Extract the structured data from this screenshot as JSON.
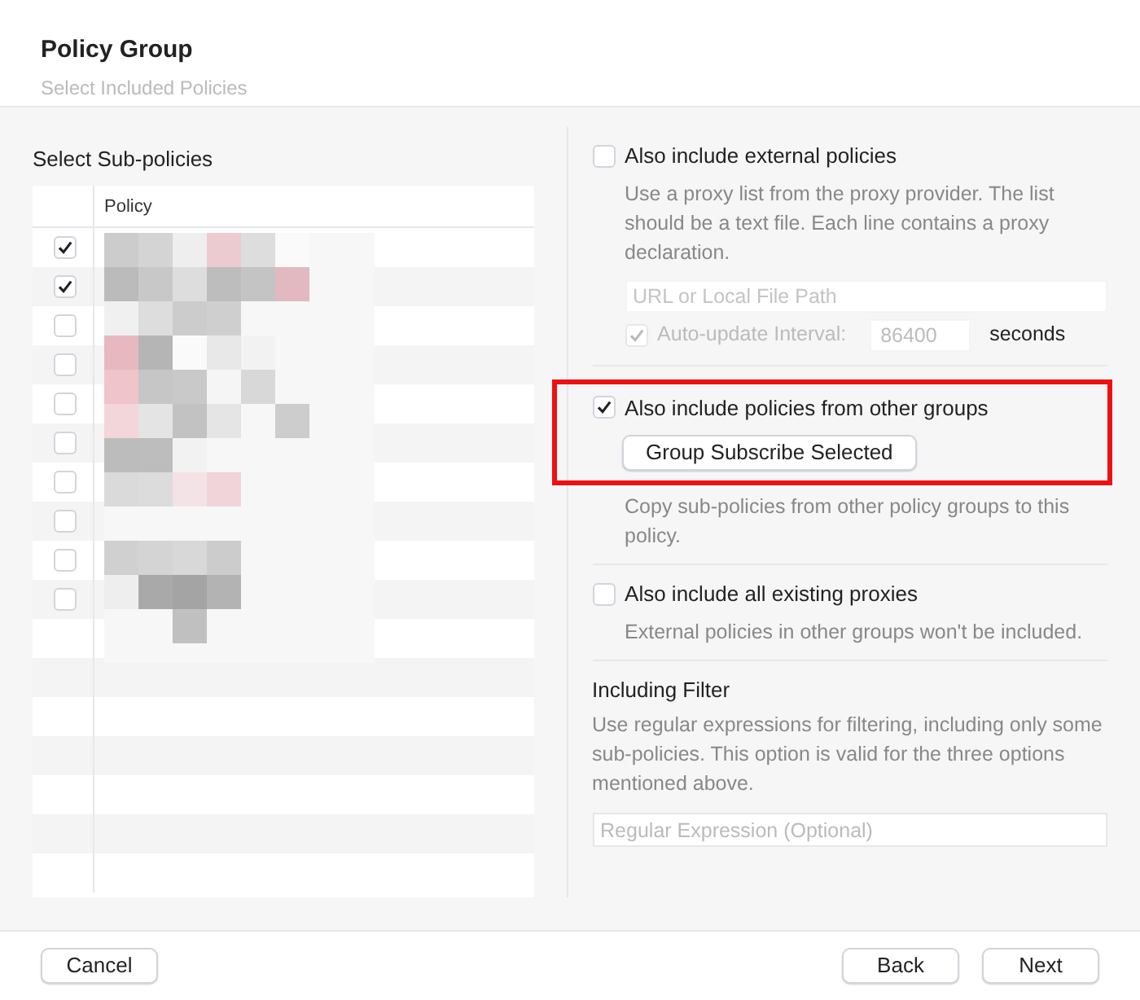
{
  "dialog": {
    "title": "Policy Group",
    "subtitle": "Select Included Policies"
  },
  "sub_policies": {
    "heading": "Select Sub-policies",
    "column": "Policy",
    "rows": [
      {
        "checked": true
      },
      {
        "checked": true
      },
      {
        "checked": false
      },
      {
        "checked": false
      },
      {
        "checked": false
      },
      {
        "checked": false
      },
      {
        "checked": false
      },
      {
        "checked": false
      },
      {
        "checked": false
      },
      {
        "checked": false
      }
    ]
  },
  "options": [
    {
      "label": "Also include external policies",
      "checked": false,
      "highlighted": false,
      "description": "Use a proxy list from the proxy provider. The list should be a text file. Each line contains a proxy declaration.",
      "url_placeholder": "URL or Local File Path",
      "auto_update": {
        "label": "Auto-update Interval:",
        "checked": true,
        "disabled": true,
        "value": "86400",
        "unit": "seconds"
      }
    },
    {
      "label": "Also include policies from other groups",
      "checked": true,
      "highlighted": true,
      "button": "Group Subscribe Selected",
      "description": "Copy sub-policies from other policy groups to this policy."
    },
    {
      "label": "Also include all existing proxies",
      "checked": false,
      "highlighted": false,
      "description": "External policies in other groups won't be included."
    }
  ],
  "filter": {
    "heading": "Including Filter",
    "description": "Use regular expressions for filtering, including only some sub-policies. This option is valid for the three options mentioned above.",
    "placeholder": "Regular Expression (Optional)"
  },
  "buttons": {
    "cancel": "Cancel",
    "back": "Back",
    "next": "Next"
  }
}
